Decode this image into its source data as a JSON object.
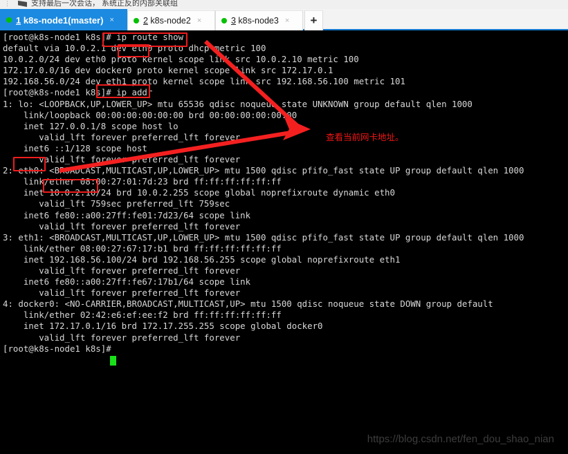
{
  "window": {
    "toolbar_hint_text": "支持最后一次会话， 系统正反的内部关联组"
  },
  "tabs": {
    "items": [
      {
        "index": "1",
        "label": " k8s-node1(master)",
        "status": "connected",
        "active": true,
        "close_label": "×"
      },
      {
        "index": "2",
        "label": " k8s-node2",
        "status": "connected",
        "active": false,
        "close_label": "×"
      },
      {
        "index": "3",
        "label": " k8s-node3",
        "status": "connected",
        "active": false,
        "close_label": "×"
      }
    ],
    "add_tab_label": "+"
  },
  "terminal": {
    "prompt_1": "[root@k8s-node1 k8s]# ",
    "command_1": "ip route show",
    "prompt_2": "[root@k8s-node1 k8s]# ",
    "command_2": "ip addr",
    "prompt_3": "[root@k8s-node1 k8s]# ",
    "cursor": "block",
    "content": "[root@k8s-node1 k8s]# ip route show\ndefault via 10.0.2.1 dev eth0 proto dhcp metric 100\n10.0.2.0/24 dev eth0 proto kernel scope link src 10.0.2.10 metric 100\n172.17.0.0/16 dev docker0 proto kernel scope link src 172.17.0.1\n192.168.56.0/24 dev eth1 proto kernel scope link src 192.168.56.100 metric 101\n[root@k8s-node1 k8s]# ip addr\n1: lo: <LOOPBACK,UP,LOWER_UP> mtu 65536 qdisc noqueue state UNKNOWN group default qlen 1000\n    link/loopback 00:00:00:00:00:00 brd 00:00:00:00:00:00\n    inet 127.0.0.1/8 scope host lo\n       valid_lft forever preferred_lft forever\n    inet6 ::1/128 scope host\n       valid_lft forever preferred_lft forever\n2: eth0: <BROADCAST,MULTICAST,UP,LOWER_UP> mtu 1500 qdisc pfifo_fast state UP group default qlen 1000\n    link/ether 08:00:27:01:7d:23 brd ff:ff:ff:ff:ff:ff\n    inet 10.0.2.10/24 brd 10.0.2.255 scope global noprefixroute dynamic eth0\n       valid_lft 759sec preferred_lft 759sec\n    inet6 fe80::a00:27ff:fe01:7d23/64 scope link\n       valid_lft forever preferred_lft forever\n3: eth1: <BROADCAST,MULTICAST,UP,LOWER_UP> mtu 1500 qdisc pfifo_fast state UP group default qlen 1000\n    link/ether 08:00:27:67:17:b1 brd ff:ff:ff:ff:ff:ff\n    inet 192.168.56.100/24 brd 192.168.56.255 scope global noprefixroute eth1\n       valid_lft forever preferred_lft forever\n    inet6 fe80::a00:27ff:fe67:17b1/64 scope link\n       valid_lft forever preferred_lft forever\n4: docker0: <NO-CARRIER,BROADCAST,MULTICAST,UP> mtu 1500 qdisc noqueue state DOWN group default\n    link/ether 02:42:e6:ef:ee:f2 brd ff:ff:ff:ff:ff:ff\n    inet 172.17.0.1/16 brd 172.17.255.255 scope global docker0\n       valid_lft forever preferred_lft forever\n[root@k8s-node1 k8s]# "
  },
  "annotations": {
    "highlight_color": "#ef1c1c",
    "boxes": [
      {
        "name": "ip-route-show",
        "text": "ip route show"
      },
      {
        "name": "eth0-route",
        "text": "eth0"
      },
      {
        "name": "ip-addr",
        "text": "# ip addr"
      },
      {
        "name": "eth0-iface",
        "text": "eth0:"
      },
      {
        "name": "eth0-ipaddr",
        "text": "10.0.2.10/"
      }
    ],
    "note_text": "查看当前网卡地址。"
  },
  "watermark": {
    "url": "https://blog.csdn.net/fen_dou_shao_nian"
  }
}
